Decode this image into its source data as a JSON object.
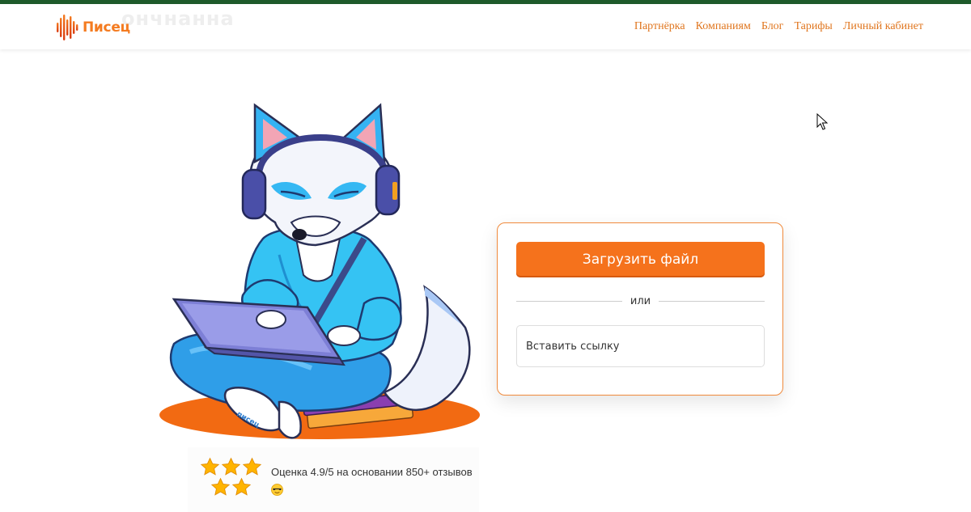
{
  "header": {
    "logo_text": "Писец",
    "ghost_title": "ончнанна",
    "nav": [
      {
        "label": "Партнёрка"
      },
      {
        "label": "Компаниям"
      },
      {
        "label": "Блог"
      },
      {
        "label": "Тарифы"
      },
      {
        "label": "Личный кабинет"
      }
    ]
  },
  "mascot": {
    "laptop_sticker": "писец"
  },
  "upload_card": {
    "upload_button_label": "Загрузить файл",
    "divider_text": "или",
    "link_input_placeholder": "Вставить ссылку"
  },
  "rating": {
    "stars_count": 5,
    "text": "Оценка 4.9/5 на основании 850+ отзывов",
    "emoji": "sunglasses-emoji"
  },
  "colors": {
    "accent": "#f5721c",
    "topline": "#1e5a2a",
    "nav_link": "#e0761f",
    "card_border": "#f08a3c"
  }
}
